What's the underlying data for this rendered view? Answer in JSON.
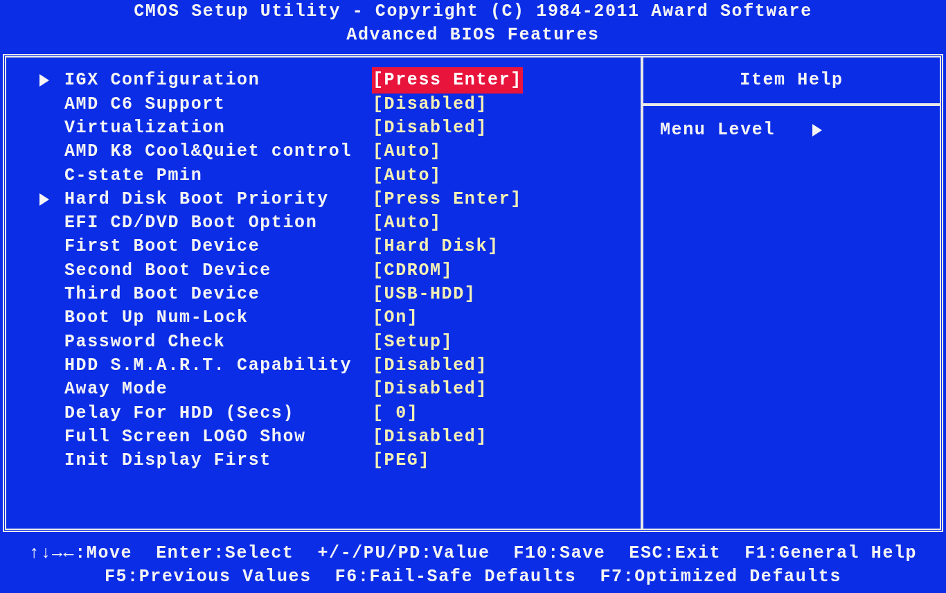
{
  "header": {
    "title": "CMOS Setup Utility - Copyright (C) 1984-2011 Award Software",
    "subtitle": "Advanced BIOS Features"
  },
  "items": [
    {
      "kind": "submenu",
      "label": "IGX Configuration",
      "value": "[Press Enter]",
      "selected": true
    },
    {
      "kind": "option",
      "label": "AMD C6 Support",
      "value": "[Disabled]",
      "selected": false
    },
    {
      "kind": "option",
      "label": "Virtualization",
      "value": "[Disabled]",
      "selected": false
    },
    {
      "kind": "option",
      "label": "AMD K8 Cool&Quiet control",
      "value": "[Auto]",
      "selected": false
    },
    {
      "kind": "option",
      "label": "C-state Pmin",
      "value": "[Auto]",
      "selected": false
    },
    {
      "kind": "submenu",
      "label": "Hard Disk Boot Priority",
      "value": "[Press Enter]",
      "selected": false
    },
    {
      "kind": "option",
      "label": "EFI CD/DVD Boot Option",
      "value": "[Auto]",
      "selected": false
    },
    {
      "kind": "option",
      "label": "First Boot Device",
      "value": "[Hard Disk]",
      "selected": false
    },
    {
      "kind": "option",
      "label": "Second Boot Device",
      "value": "[CDROM]",
      "selected": false
    },
    {
      "kind": "option",
      "label": "Third Boot Device",
      "value": "[USB-HDD]",
      "selected": false
    },
    {
      "kind": "option",
      "label": "Boot Up Num-Lock",
      "value": "[On]",
      "selected": false
    },
    {
      "kind": "option",
      "label": "Password Check",
      "value": "[Setup]",
      "selected": false
    },
    {
      "kind": "option",
      "label": "HDD S.M.A.R.T. Capability",
      "value": "[Disabled]",
      "selected": false
    },
    {
      "kind": "option",
      "label": "Away Mode",
      "value": "[Disabled]",
      "selected": false
    },
    {
      "kind": "option",
      "label": "Delay For HDD (Secs)",
      "value": "[ 0]",
      "selected": false
    },
    {
      "kind": "option",
      "label": "Full Screen LOGO Show",
      "value": "[Disabled]",
      "selected": false
    },
    {
      "kind": "option",
      "label": "Init Display First",
      "value": "[PEG]",
      "selected": false
    }
  ],
  "help": {
    "title": "Item Help",
    "menu_level": "Menu Level"
  },
  "footer": [
    [
      "↑↓→←:Move",
      "Enter:Select",
      "+/-/PU/PD:Value",
      "F10:Save",
      "ESC:Exit",
      "F1:General Help"
    ],
    [
      "F5:Previous Values",
      "F6:Fail-Safe Defaults",
      "F7:Optimized Defaults"
    ]
  ]
}
